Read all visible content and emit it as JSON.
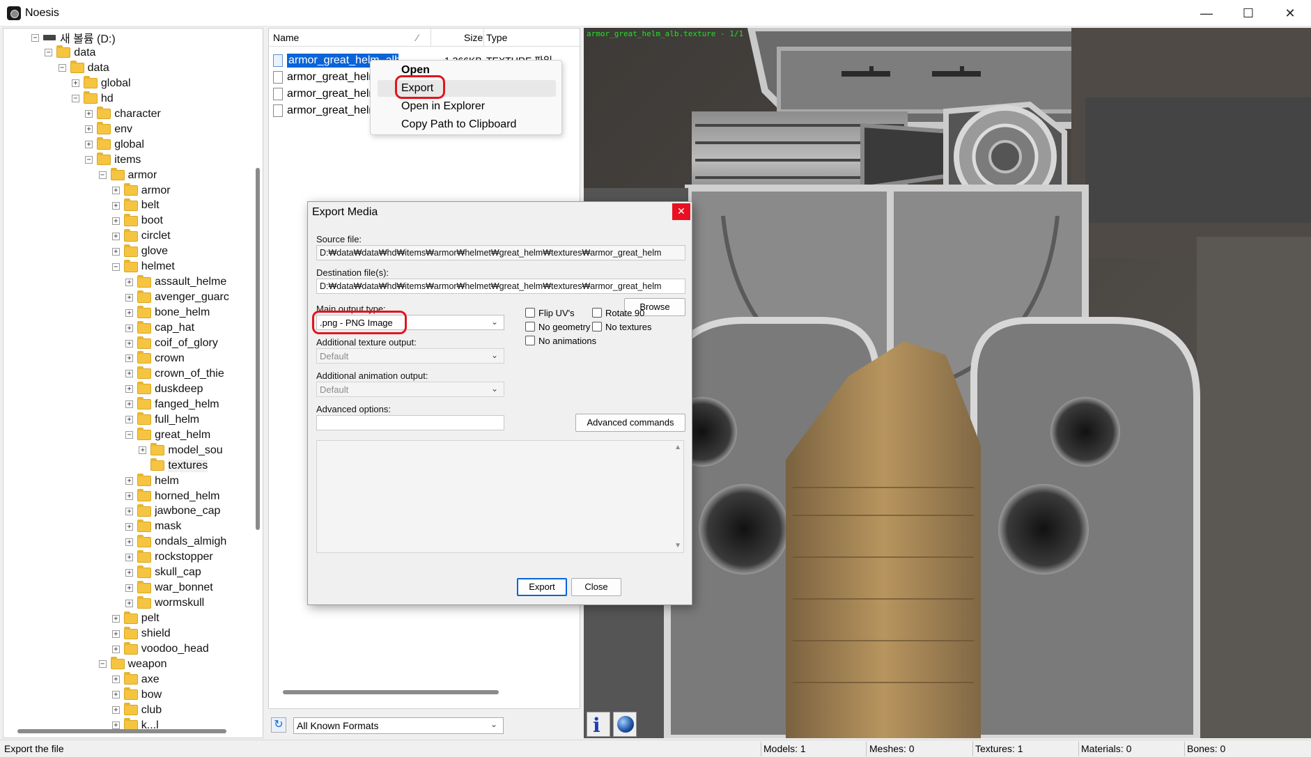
{
  "window": {
    "title": "Noesis",
    "minimize": "—",
    "maximize": "☐",
    "close": "✕"
  },
  "tree": {
    "items": [
      {
        "label": "새 볼륨 (D:)",
        "depth": 0,
        "expander": "⊟",
        "icon": "drive-icon"
      },
      {
        "label": "data",
        "depth": 1,
        "expander": "⊟",
        "icon": "folder-icon"
      },
      {
        "label": "data",
        "depth": 2,
        "expander": "⊟",
        "icon": "folder-icon"
      },
      {
        "label": "global",
        "depth": 3,
        "expander": "⊞",
        "icon": "folder-icon"
      },
      {
        "label": "hd",
        "depth": 3,
        "expander": "⊟",
        "icon": "folder-icon"
      },
      {
        "label": "character",
        "depth": 4,
        "expander": "⊞",
        "icon": "folder-icon"
      },
      {
        "label": "env",
        "depth": 4,
        "expander": "⊞",
        "icon": "folder-icon"
      },
      {
        "label": "global",
        "depth": 4,
        "expander": "⊞",
        "icon": "folder-icon"
      },
      {
        "label": "items",
        "depth": 4,
        "expander": "⊟",
        "icon": "folder-icon"
      },
      {
        "label": "armor",
        "depth": 5,
        "expander": "⊟",
        "icon": "folder-icon"
      },
      {
        "label": "armor",
        "depth": 6,
        "expander": "⊞",
        "icon": "folder-icon"
      },
      {
        "label": "belt",
        "depth": 6,
        "expander": "⊞",
        "icon": "folder-icon"
      },
      {
        "label": "boot",
        "depth": 6,
        "expander": "⊞",
        "icon": "folder-icon"
      },
      {
        "label": "circlet",
        "depth": 6,
        "expander": "⊞",
        "icon": "folder-icon"
      },
      {
        "label": "glove",
        "depth": 6,
        "expander": "⊞",
        "icon": "folder-icon"
      },
      {
        "label": "helmet",
        "depth": 6,
        "expander": "⊟",
        "icon": "folder-icon"
      },
      {
        "label": "assault_helme",
        "depth": 7,
        "expander": "⊞",
        "icon": "folder-icon"
      },
      {
        "label": "avenger_guarc",
        "depth": 7,
        "expander": "⊞",
        "icon": "folder-icon"
      },
      {
        "label": "bone_helm",
        "depth": 7,
        "expander": "⊞",
        "icon": "folder-icon"
      },
      {
        "label": "cap_hat",
        "depth": 7,
        "expander": "⊞",
        "icon": "folder-icon"
      },
      {
        "label": "coif_of_glory",
        "depth": 7,
        "expander": "⊞",
        "icon": "folder-icon"
      },
      {
        "label": "crown",
        "depth": 7,
        "expander": "⊞",
        "icon": "folder-icon"
      },
      {
        "label": "crown_of_thie",
        "depth": 7,
        "expander": "⊞",
        "icon": "folder-icon"
      },
      {
        "label": "duskdeep",
        "depth": 7,
        "expander": "⊞",
        "icon": "folder-icon"
      },
      {
        "label": "fanged_helm",
        "depth": 7,
        "expander": "⊞",
        "icon": "folder-icon"
      },
      {
        "label": "full_helm",
        "depth": 7,
        "expander": "⊞",
        "icon": "folder-icon"
      },
      {
        "label": "great_helm",
        "depth": 7,
        "expander": "⊟",
        "icon": "folder-icon"
      },
      {
        "label": "model_sou",
        "depth": 8,
        "expander": "⊞",
        "icon": "folder-icon"
      },
      {
        "label": "textures",
        "depth": 8,
        "expander": "",
        "icon": "folder-icon",
        "selected": true
      },
      {
        "label": "helm",
        "depth": 7,
        "expander": "⊞",
        "icon": "folder-icon"
      },
      {
        "label": "horned_helm",
        "depth": 7,
        "expander": "⊞",
        "icon": "folder-icon"
      },
      {
        "label": "jawbone_cap",
        "depth": 7,
        "expander": "⊞",
        "icon": "folder-icon"
      },
      {
        "label": "mask",
        "depth": 7,
        "expander": "⊞",
        "icon": "folder-icon"
      },
      {
        "label": "ondals_almigh",
        "depth": 7,
        "expander": "⊞",
        "icon": "folder-icon"
      },
      {
        "label": "rockstopper",
        "depth": 7,
        "expander": "⊞",
        "icon": "folder-icon"
      },
      {
        "label": "skull_cap",
        "depth": 7,
        "expander": "⊞",
        "icon": "folder-icon"
      },
      {
        "label": "war_bonnet",
        "depth": 7,
        "expander": "⊞",
        "icon": "folder-icon"
      },
      {
        "label": "wormskull",
        "depth": 7,
        "expander": "⊞",
        "icon": "folder-icon"
      },
      {
        "label": "pelt",
        "depth": 6,
        "expander": "⊞",
        "icon": "folder-icon"
      },
      {
        "label": "shield",
        "depth": 6,
        "expander": "⊞",
        "icon": "folder-icon"
      },
      {
        "label": "voodoo_head",
        "depth": 6,
        "expander": "⊞",
        "icon": "folder-icon"
      },
      {
        "label": "weapon",
        "depth": 5,
        "expander": "⊟",
        "icon": "folder-icon"
      },
      {
        "label": "axe",
        "depth": 6,
        "expander": "⊞",
        "icon": "folder-icon"
      },
      {
        "label": "bow",
        "depth": 6,
        "expander": "⊞",
        "icon": "folder-icon"
      },
      {
        "label": "club",
        "depth": 6,
        "expander": "⊞",
        "icon": "folder-icon"
      },
      {
        "label": "k...l",
        "depth": 6,
        "expander": "⊞",
        "icon": "folder-icon"
      }
    ]
  },
  "filelist": {
    "columns": {
      "name": "Name",
      "size": "Size",
      "type": "Type"
    },
    "files": [
      {
        "name": "armor_great_helm_alb",
        "size": "1,366KB",
        "type": "TEXTURE 파일",
        "selected": true
      },
      {
        "name": "armor_great_helm",
        "size": "",
        "type": "",
        "selected": false
      },
      {
        "name": "armor_great_helm",
        "size": "",
        "type": "",
        "selected": false
      },
      {
        "name": "armor_great_helm",
        "size": "",
        "type": "",
        "selected": false
      }
    ]
  },
  "format_filter": {
    "refresh_icon": "↻",
    "value": "All Known Formats",
    "chevron": "⌄"
  },
  "context_menu": {
    "items": [
      "Open",
      "Export",
      "Open in Explorer",
      "Copy Path to Clipboard"
    ]
  },
  "viewer": {
    "caption": "armor_great_helm_alb.texture - 1/1",
    "info_icon": "i"
  },
  "dialog": {
    "title": "Export Media",
    "close": "✕",
    "source_label": "Source file:",
    "source_value": "D:₩data₩data₩hd₩items₩armor₩helmet₩great_helm₩textures₩armor_great_helm",
    "dest_label": "Destination file(s):",
    "dest_value": "D:₩data₩data₩hd₩items₩armor₩helmet₩great_helm₩textures₩armor_great_helm",
    "browse": "Browse",
    "main_output_label": "Main output type:",
    "main_output_value": ".png - PNG Image",
    "add_texture_label": "Additional texture output:",
    "add_texture_value": "Default",
    "add_anim_label": "Additional animation output:",
    "add_anim_value": "Default",
    "advanced_label": "Advanced options:",
    "advanced_value": "",
    "advanced_commands": "Advanced commands",
    "checkboxes": {
      "flip_uvs": "Flip UV's",
      "rotate_90": "Rotate 90",
      "no_geometry": "No geometry",
      "no_textures": "No textures",
      "no_animations": "No animations"
    },
    "export_button": "Export",
    "close_button": "Close",
    "scroll_up": "▲",
    "scroll_down": "▼"
  },
  "statusbar": {
    "message": "Export the file",
    "models": "Models: 1",
    "meshes": "Meshes: 0",
    "textures": "Textures: 1",
    "materials": "Materials: 0",
    "bones": "Bones: 0"
  },
  "colors": {
    "selection": "#0a64d8",
    "annotation": "#e0151e",
    "caption_green": "#22e022",
    "folder": "#f5c542"
  }
}
